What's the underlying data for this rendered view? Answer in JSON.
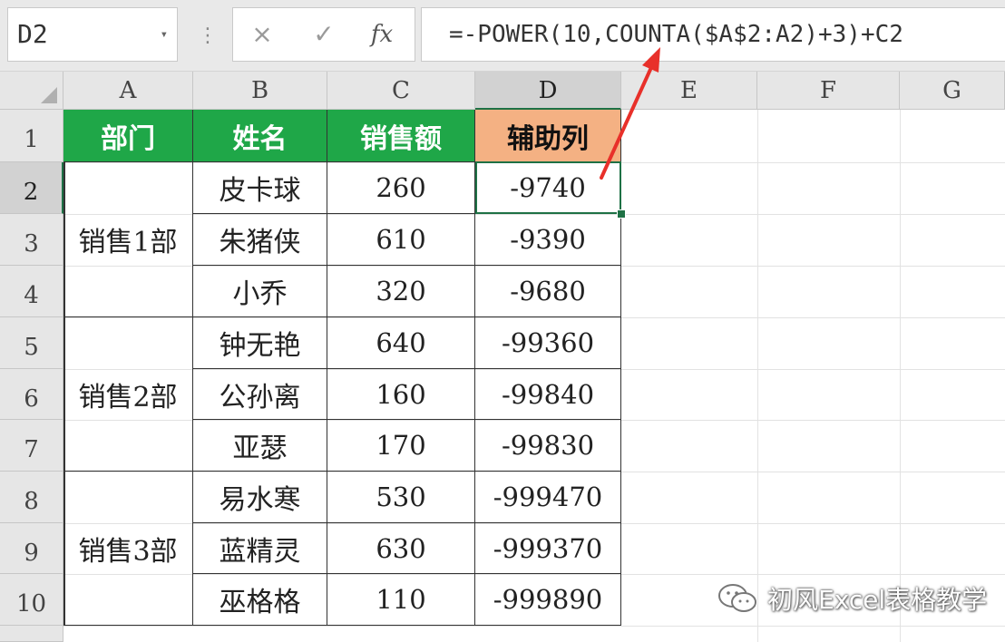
{
  "formula_bar": {
    "name_box": "D2",
    "cancel_icon": "×",
    "enter_icon": "✓",
    "fx_label": "fx",
    "formula": "=-POWER(10,COUNTA($A$2:A2)+3)+C2"
  },
  "columns": [
    "A",
    "B",
    "C",
    "D",
    "E",
    "F",
    "G"
  ],
  "rows": [
    "1",
    "2",
    "3",
    "4",
    "5",
    "6",
    "7",
    "8",
    "9",
    "10"
  ],
  "table": {
    "headers": [
      "部门",
      "姓名",
      "销售额",
      "辅助列"
    ],
    "departments": [
      "销售1部",
      "销售2部",
      "销售3部"
    ],
    "names": [
      "皮卡球",
      "朱猪侠",
      "小乔",
      "钟无艳",
      "公孙离",
      "亚瑟",
      "易水寒",
      "蓝精灵",
      "巫格格"
    ],
    "sales": [
      "260",
      "610",
      "320",
      "640",
      "160",
      "170",
      "530",
      "630",
      "110"
    ],
    "helper": [
      "-9740",
      "-9390",
      "-9680",
      "-99360",
      "-99840",
      "-99830",
      "-999470",
      "-999370",
      "-999890"
    ]
  },
  "colors": {
    "header_green": "#1fa748",
    "header_orange": "#f4b183",
    "selection": "#1e7145",
    "arrow": "#e8302a"
  },
  "watermark": "初风Excel表格教学"
}
